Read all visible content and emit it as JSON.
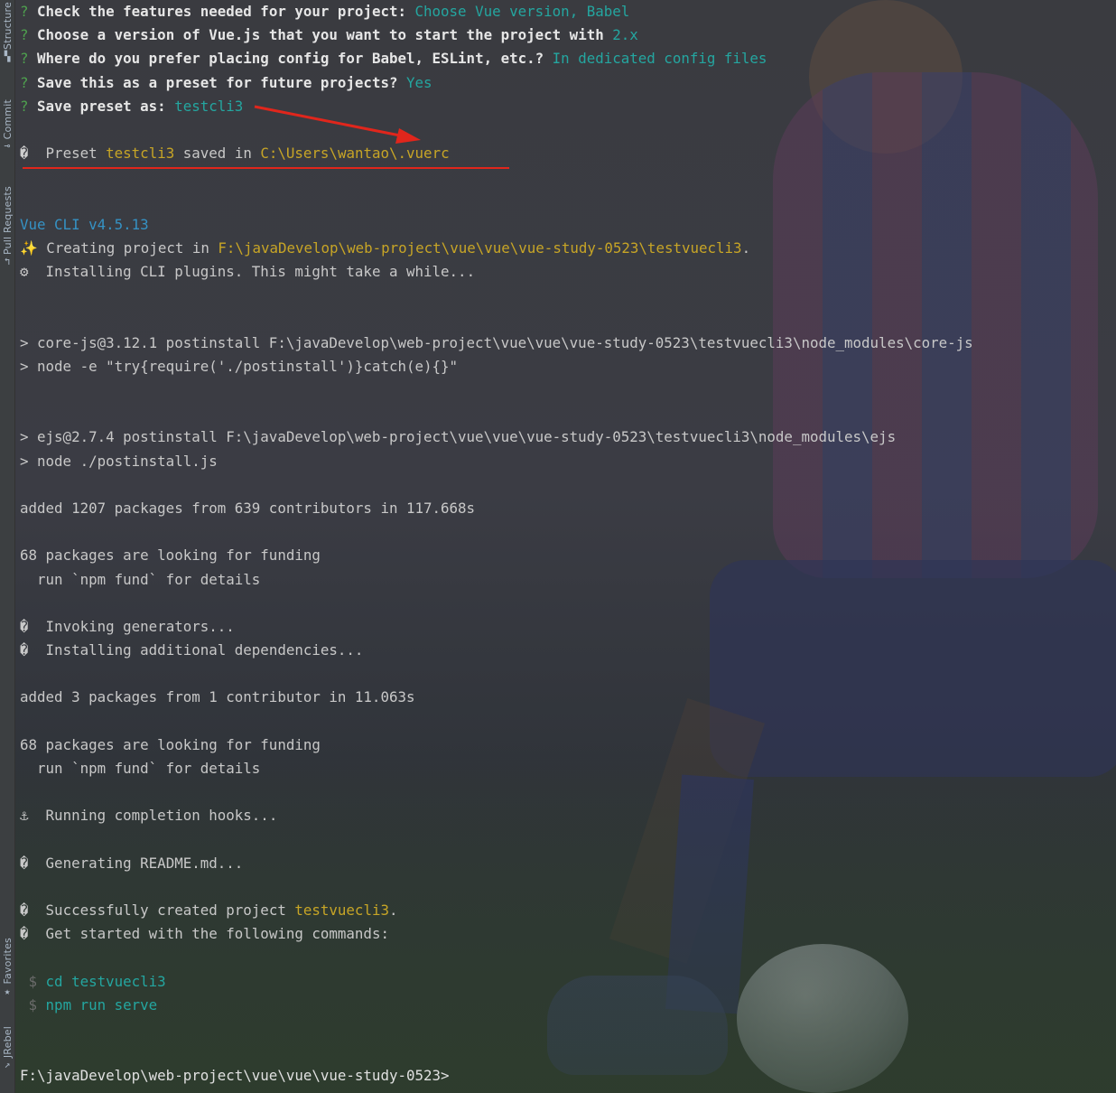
{
  "sidebar": {
    "items": [
      {
        "label": "Structure",
        "icon": "structure-icon"
      },
      {
        "label": "Commit",
        "icon": "commit-icon"
      },
      {
        "label": "Pull Requests",
        "icon": "pull-requests-icon"
      },
      {
        "label": "Favorites",
        "icon": "star-icon"
      },
      {
        "label": "JRebel",
        "icon": "jrebel-icon"
      }
    ]
  },
  "terminal": {
    "q1": {
      "prefix": "?",
      "question": "Check the features needed for your project:",
      "answer": "Choose Vue version, Babel"
    },
    "q2": {
      "prefix": "?",
      "question": "Choose a version of Vue.js that you want to start the project with",
      "answer": "2.x"
    },
    "q3": {
      "prefix": "?",
      "question": "Where do you prefer placing config for Babel, ESLint, etc.?",
      "answer": "In dedicated config files"
    },
    "q4": {
      "prefix": "?",
      "question": "Save this as a preset for future projects?",
      "answer": "Yes"
    },
    "q5": {
      "prefix": "?",
      "question": "Save preset as:",
      "answer": "testcli3"
    },
    "preset_saved": {
      "glyph": "�",
      "text1": "Preset",
      "name": "testcli3",
      "text2": "saved in",
      "path": "C:\\Users\\wantao\\.vuerc"
    },
    "vue_cli_version": "Vue CLI v4.5.13",
    "creating": {
      "glyph": "✨",
      "text": "Creating project in",
      "path": "F:\\javaDevelop\\web-project\\vue\\vue\\vue-study-0523\\testvuecli3",
      "suffix": "."
    },
    "installing_plugins": {
      "glyph": "⚙",
      "text": "Installing CLI plugins. This might take a while..."
    },
    "corejs_postinstall": "> core-js@3.12.1 postinstall F:\\javaDevelop\\web-project\\vue\\vue\\vue-study-0523\\testvuecli3\\node_modules\\core-js",
    "corejs_node": "> node -e \"try{require('./postinstall')}catch(e){}\"",
    "ejs_postinstall": "> ejs@2.7.4 postinstall F:\\javaDevelop\\web-project\\vue\\vue\\vue-study-0523\\testvuecli3\\node_modules\\ejs",
    "ejs_node": "> node ./postinstall.js",
    "added_packages_1": "added 1207 packages from 639 contributors in 117.668s",
    "funding_1": "68 packages are looking for funding",
    "fund_hint_1": "  run `npm fund` for details",
    "invoking": {
      "glyph": "�",
      "text": "Invoking generators..."
    },
    "installing_deps": {
      "glyph": "�",
      "text": "Installing additional dependencies..."
    },
    "added_packages_2": "added 3 packages from 1 contributor in 11.063s",
    "funding_2": "68 packages are looking for funding",
    "fund_hint_2": "  run `npm fund` for details",
    "completion_hooks": {
      "glyph": "⚓",
      "text": "Running completion hooks..."
    },
    "readme": {
      "glyph": "�",
      "text": "Generating README.md..."
    },
    "success": {
      "glyph": "�",
      "text": "Successfully created project",
      "name": "testvuecli3",
      "suffix": "."
    },
    "get_started": {
      "glyph": "�",
      "text": "Get started with the following commands:"
    },
    "cmd1": {
      "dollar": "$",
      "cmd": "cd testvuecli3"
    },
    "cmd2": {
      "dollar": "$",
      "cmd": "npm run serve"
    },
    "prompt": "F:\\javaDevelop\\web-project\\vue\\vue\\vue-study-0523>"
  },
  "colors": {
    "accent_red": "#e0261c",
    "answer_cyan": "#24a6a0",
    "path_yellow": "#c7a526",
    "version_blue": "#3592c4"
  }
}
